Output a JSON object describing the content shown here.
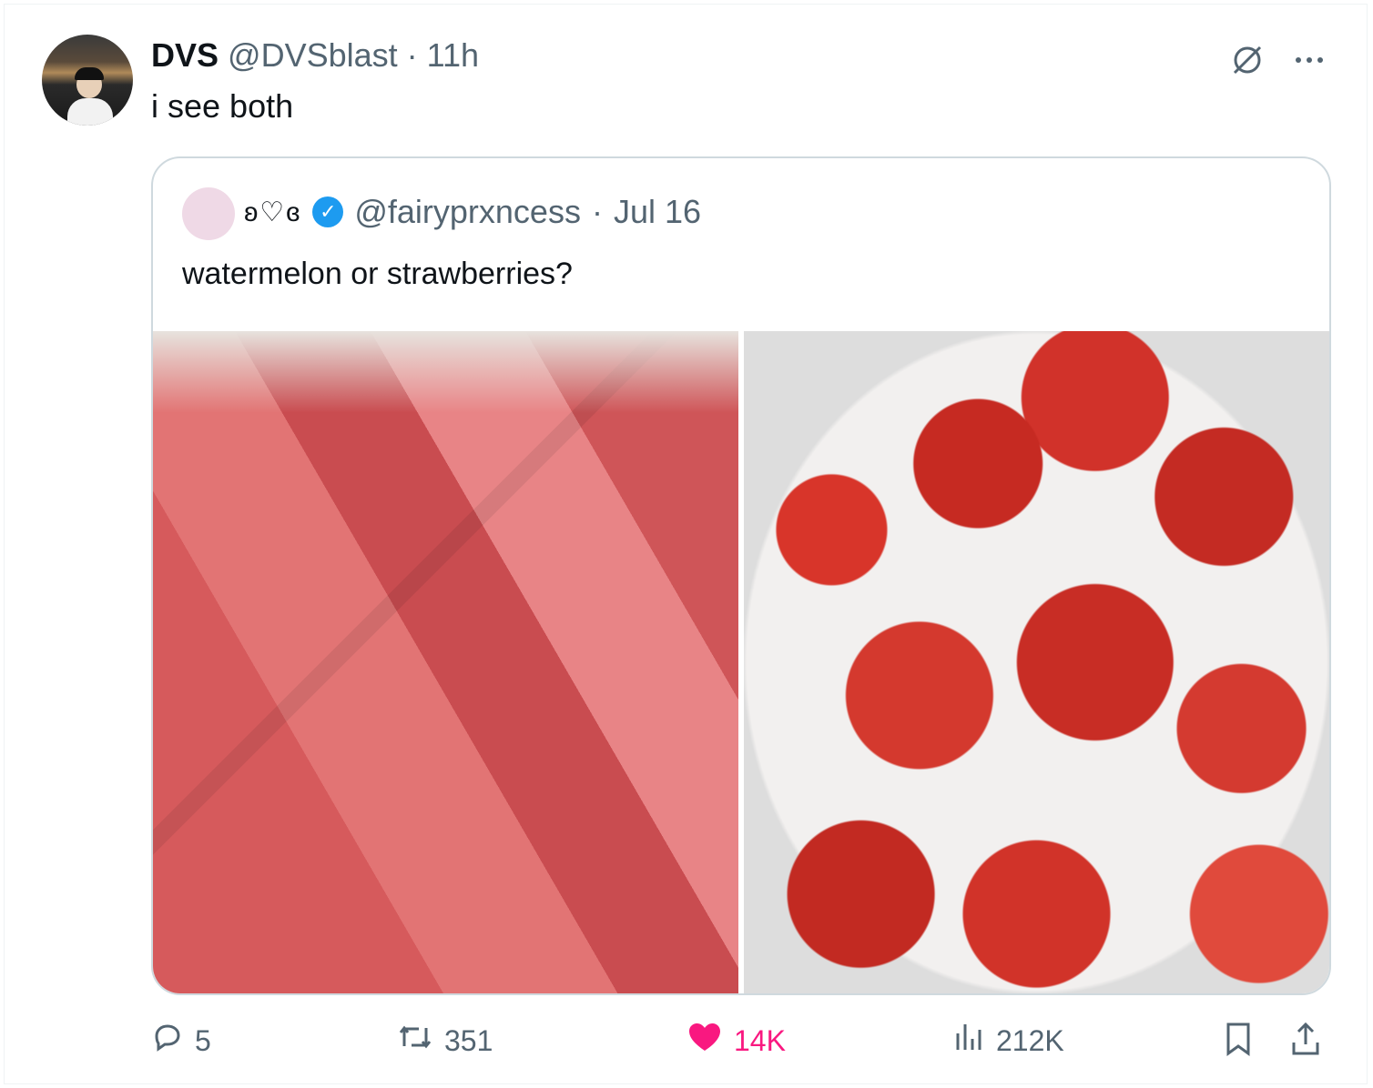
{
  "tweet": {
    "display_name": "DVS",
    "handle": "@DVSblast",
    "separator": "·",
    "time": "11h",
    "text": "i see both"
  },
  "quoted": {
    "name_glyphs": "ʚ♡ɞ",
    "handle": "@fairyprxncess",
    "separator": "·",
    "date": "Jul 16",
    "text": "watermelon or strawberries?"
  },
  "actions": {
    "replies": "5",
    "reposts": "351",
    "likes": "14K",
    "views": "212K"
  },
  "icons": {
    "grok": "grok-icon",
    "more": "more-icon",
    "reply": "reply-icon",
    "repost": "repost-icon",
    "like": "heart-icon",
    "views": "views-icon",
    "bookmark": "bookmark-icon",
    "share": "share-icon"
  },
  "colors": {
    "like_active": "#f91880",
    "verified": "#1d9bf0",
    "secondary_text": "#536471"
  }
}
